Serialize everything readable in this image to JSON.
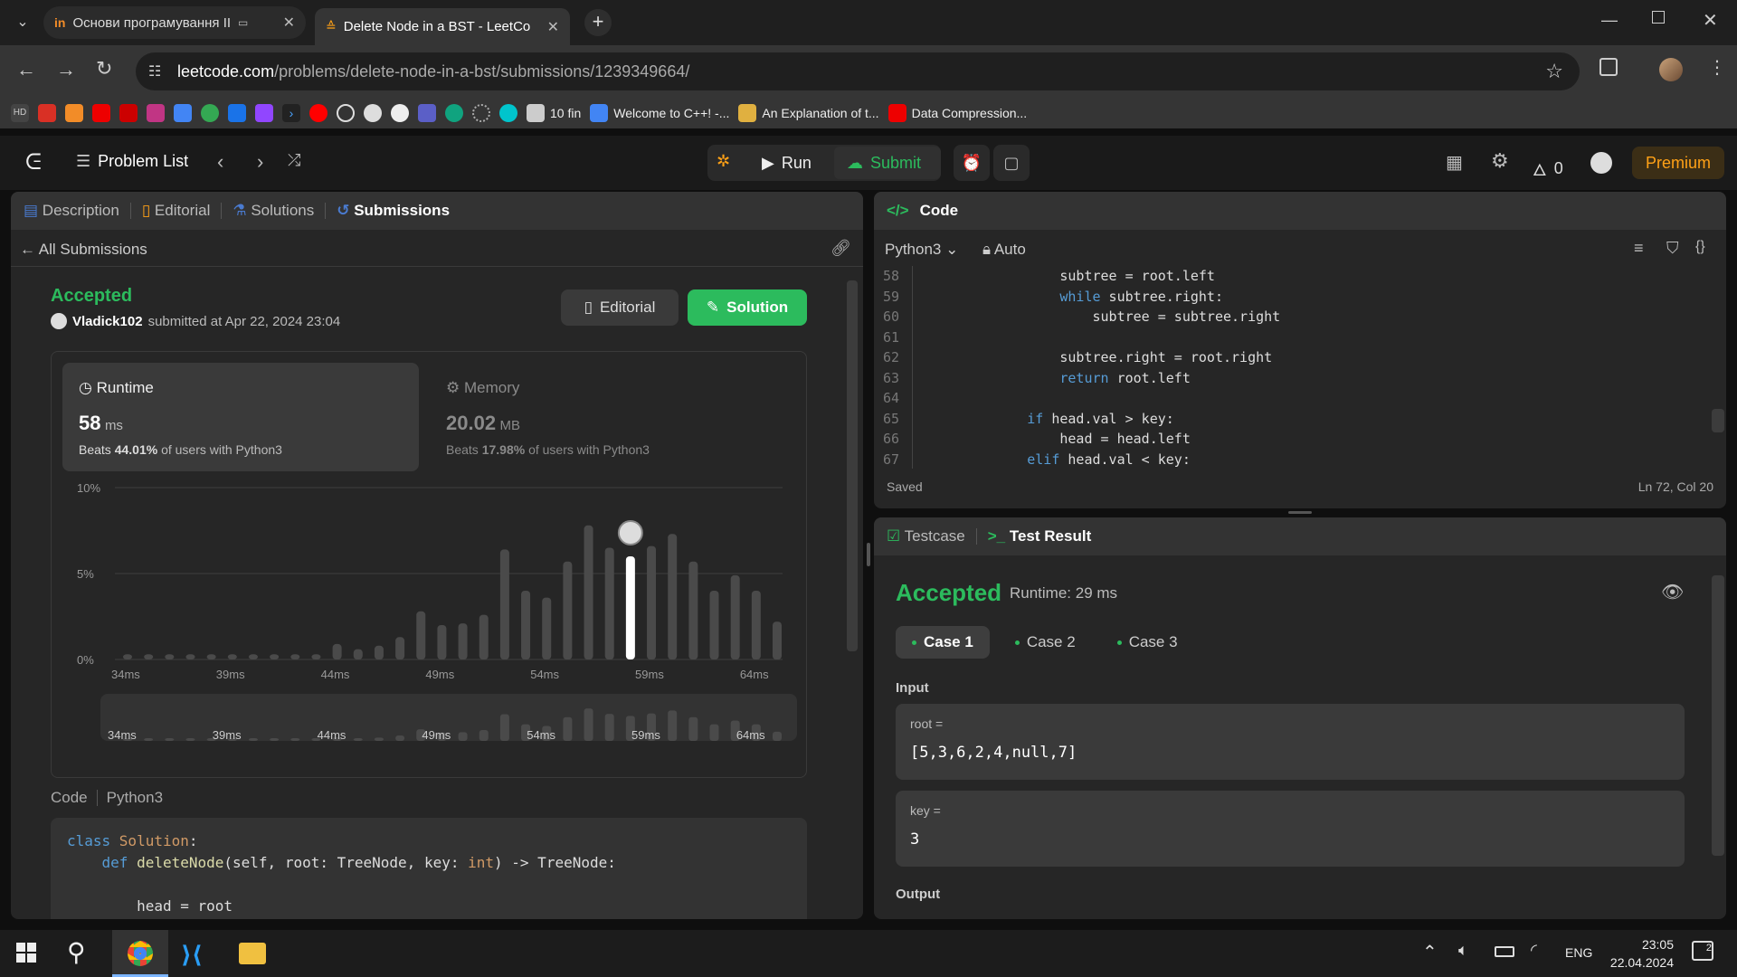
{
  "browser": {
    "tabs": [
      {
        "title": "Основи програмування ІІ"
      },
      {
        "title": "Delete Node in a BST - LeetCo"
      }
    ],
    "url_host": "leetcode.com",
    "url_path": "/problems/delete-node-in-a-bst/submissions/1239349664/",
    "bookmarks": [
      {
        "label": "10 fin"
      },
      {
        "label": "Welcome to C++! -..."
      },
      {
        "label": "An Explanation of t..."
      },
      {
        "label": "Data Compression..."
      }
    ]
  },
  "leetcode_bar": {
    "problem_list": "Problem List",
    "run": "Run",
    "submit": "Submit",
    "streak": "0",
    "premium": "Premium"
  },
  "left_panel": {
    "tabs": {
      "description": "Description",
      "editorial": "Editorial",
      "solutions": "Solutions",
      "submissions": "Submissions"
    },
    "all_submissions": "All Submissions",
    "status": "Accepted",
    "user": "Vladick102",
    "submitted_text": "submitted at Apr 22, 2024 23:04",
    "editorial_btn": "Editorial",
    "solution_btn": "Solution",
    "runtime": {
      "label": "Runtime",
      "value": "58",
      "unit": "ms",
      "beats_prefix": "Beats",
      "beats_pct": "44.01%",
      "beats_suffix": "of users with Python3"
    },
    "memory": {
      "label": "Memory",
      "value": "20.02",
      "unit": "MB",
      "beats_prefix": "Beats",
      "beats_pct": "17.98%",
      "beats_suffix": "of users with Python3"
    },
    "code_label": "Code",
    "code_lang": "Python3",
    "code_lines": [
      {
        "parts": [
          [
            "kw",
            "class "
          ],
          [
            "ty",
            "Solution"
          ],
          [
            "",
            ":"
          ]
        ]
      },
      {
        "parts": [
          [
            "",
            "    "
          ],
          [
            "kw",
            "def "
          ],
          [
            "fn",
            "deleteNode"
          ],
          [
            "",
            "(self, root: TreeNode, key: "
          ],
          [
            "ty",
            "int"
          ],
          [
            "",
            ") -> TreeNode:"
          ]
        ]
      },
      {
        "parts": [
          [
            "",
            ""
          ]
        ]
      },
      {
        "parts": [
          [
            "",
            "        head = root"
          ]
        ]
      }
    ]
  },
  "chart_data": {
    "type": "bar",
    "ylabel_ticks": [
      "10%",
      "5%",
      "0%"
    ],
    "xtick_labels": [
      "34ms",
      "39ms",
      "44ms",
      "49ms",
      "54ms",
      "59ms",
      "64ms"
    ],
    "ylim": [
      0,
      10
    ],
    "x": [
      34,
      35,
      36,
      37,
      38,
      39,
      40,
      41,
      42,
      43,
      44,
      45,
      46,
      47,
      48,
      49,
      50,
      51,
      52,
      53,
      54,
      55,
      56,
      57,
      58,
      59,
      60,
      61,
      62,
      63,
      64,
      65
    ],
    "values": [
      0.3,
      0.3,
      0.3,
      0.3,
      0.3,
      0.3,
      0.3,
      0.3,
      0.3,
      0.3,
      0.9,
      0.6,
      0.8,
      1.3,
      2.8,
      2.0,
      2.1,
      2.6,
      6.4,
      4.0,
      3.6,
      5.7,
      7.8,
      6.5,
      6.0,
      6.6,
      7.3,
      5.7,
      4.0,
      4.9,
      4.0,
      2.2
    ],
    "highlight_x": 58,
    "highlight_value": 6.6
  },
  "right_panel": {
    "code_tab": "Code",
    "lang": "Python3",
    "auto": "Auto",
    "line_numbers": [
      "58",
      "59",
      "60",
      "61",
      "62",
      "63",
      "64",
      "65",
      "66",
      "67"
    ],
    "code_lines": [
      "            subtree = root.left",
      "            while subtree.right:",
      "                subtree = subtree.right",
      "",
      "            subtree.right = root.right",
      "            return root.left",
      "",
      "        if head.val > key:",
      "            head = head.left",
      "        elif head.val < key:"
    ],
    "saved": "Saved",
    "cursor": "Ln 72, Col 20",
    "testcase_tab": "Testcase",
    "result_tab": "Test Result",
    "result_status": "Accepted",
    "result_runtime": "Runtime: 29 ms",
    "cases": [
      "Case 1",
      "Case 2",
      "Case 3"
    ],
    "input_label": "Input",
    "inputs": [
      {
        "name": "root =",
        "value": "[5,3,6,2,4,null,7]"
      },
      {
        "name": "key =",
        "value": "3"
      }
    ],
    "output_label": "Output"
  },
  "taskbar": {
    "lang": "ENG",
    "time": "23:05",
    "date": "22.04.2024",
    "notif_count": "2"
  }
}
